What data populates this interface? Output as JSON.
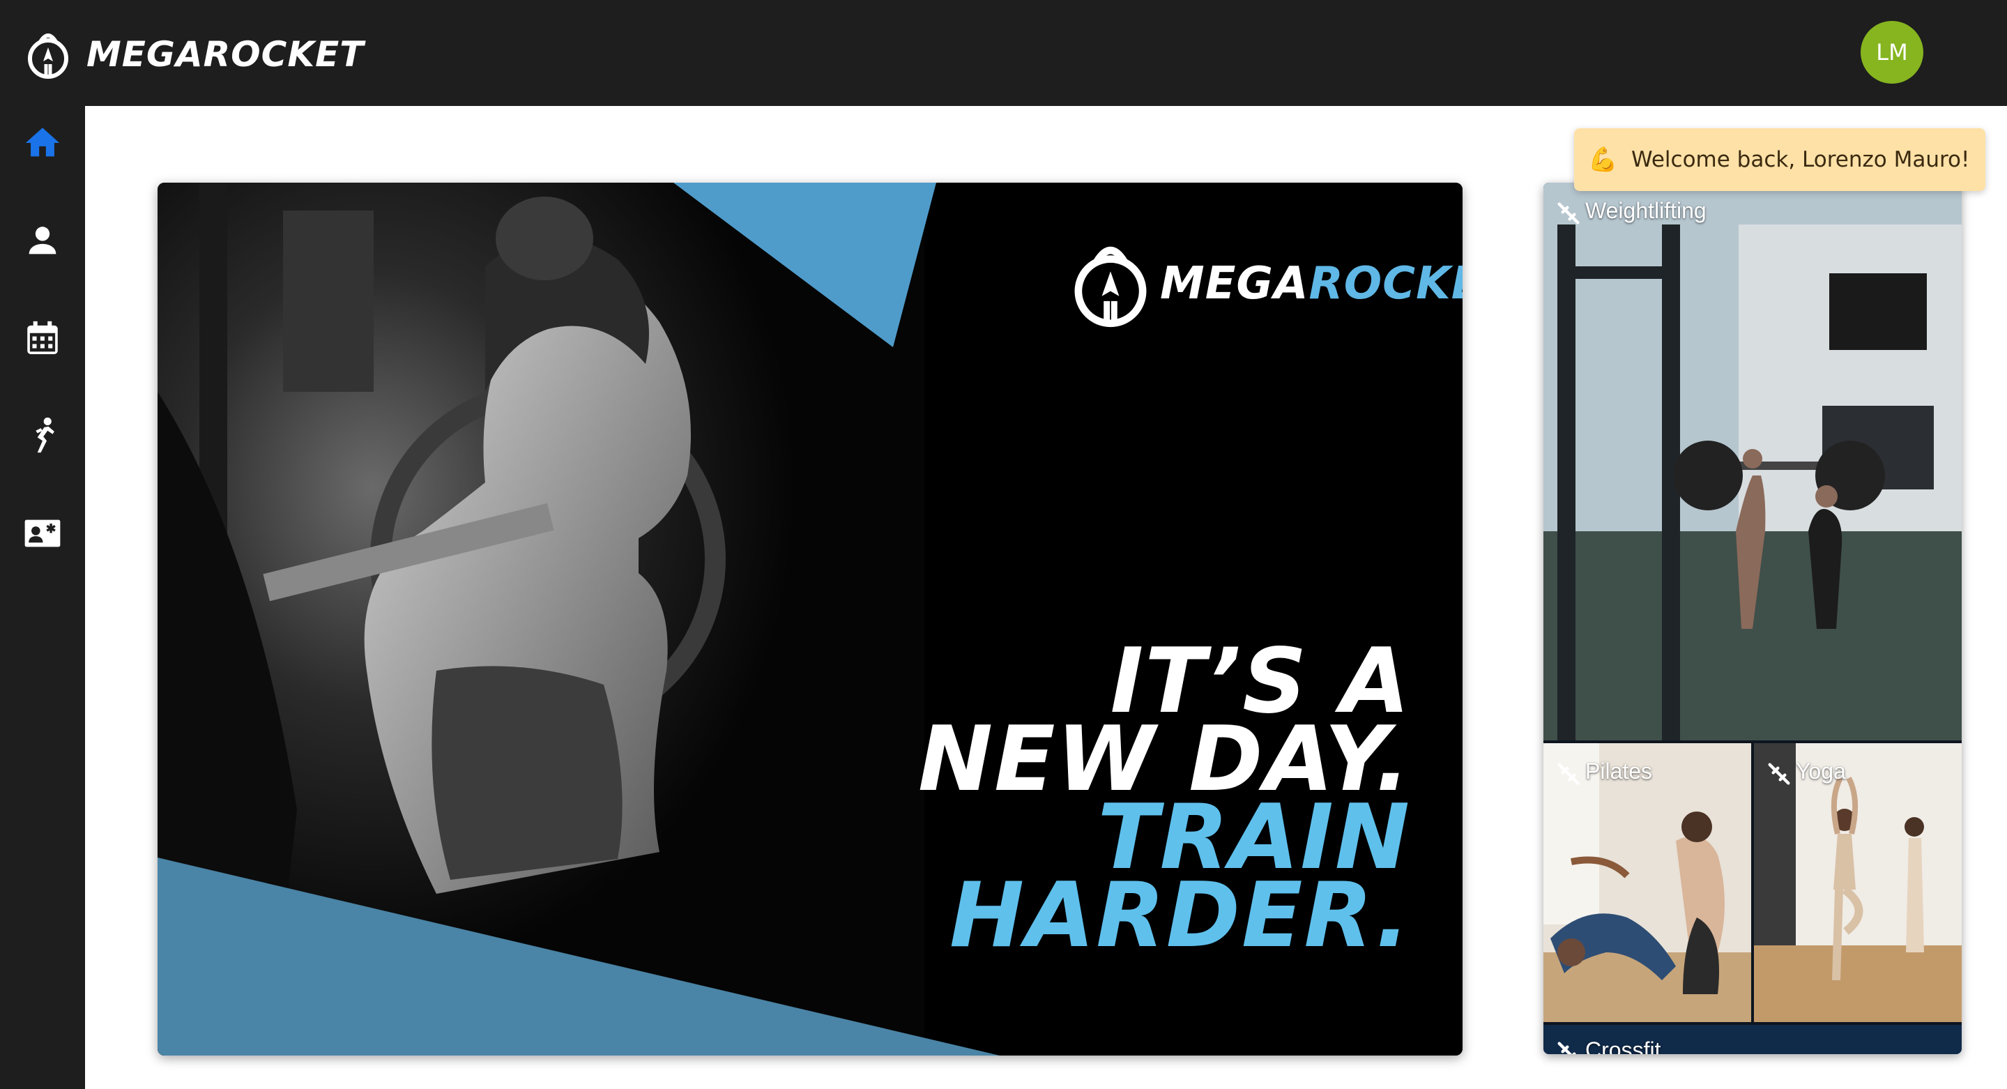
{
  "header": {
    "brand": "MEGAROCKET",
    "avatar_initials": "LM"
  },
  "sidebar": {
    "items": [
      {
        "icon": "home-icon",
        "active": true
      },
      {
        "icon": "user-icon",
        "active": false
      },
      {
        "icon": "calendar-icon",
        "active": false
      },
      {
        "icon": "activity-icon",
        "active": false
      },
      {
        "icon": "member-card-icon",
        "active": false
      }
    ]
  },
  "hero": {
    "brand_part1": "MEGA",
    "brand_part2": "ROCKET",
    "slogan_line1": "IT’S A",
    "slogan_line2": "NEW DAY.",
    "slogan_line3": "TRAIN",
    "slogan_line4": "HARDER."
  },
  "activities": [
    {
      "label": "Weightlifting",
      "icon": "dumbbell-icon"
    },
    {
      "label": "Pilates",
      "icon": "dumbbell-icon"
    },
    {
      "label": "Yoga",
      "icon": "dumbbell-icon"
    },
    {
      "label": "Crossfit",
      "icon": "dumbbell-icon"
    }
  ],
  "toast": {
    "icon": "flexed-biceps-icon",
    "message": "Welcome back, Lorenzo Mauro!"
  },
  "colors": {
    "topbar": "#1e1e1e",
    "accent_blue": "#5fc0ec",
    "active_nav": "#1a73e8",
    "avatar": "#86b51f",
    "toast_bg": "#fee1a7"
  }
}
